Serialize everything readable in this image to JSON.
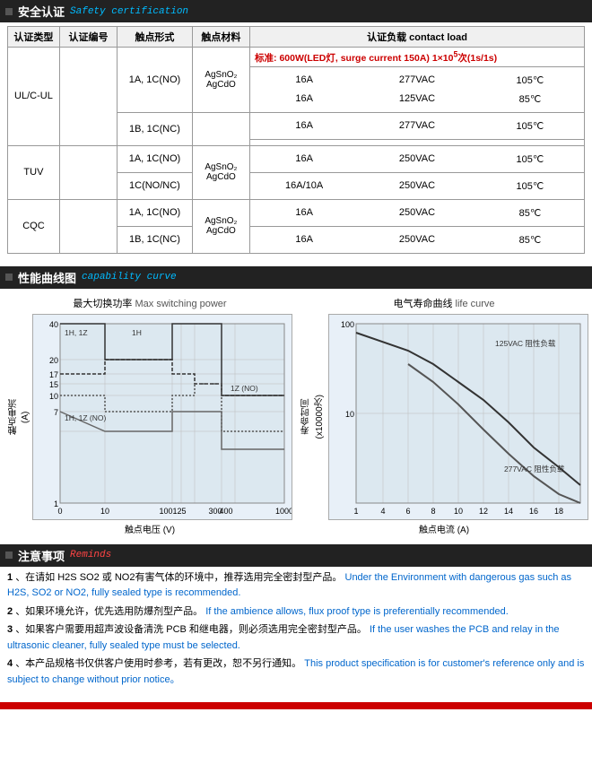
{
  "safety_section": {
    "title_zh": "安全认证",
    "title_en": "Safety certification",
    "table": {
      "headers": [
        "认证类型",
        "认证编号",
        "触点形式",
        "触点材料",
        "认证负载 contact load"
      ],
      "rows": [
        {
          "type": "UL/C-UL",
          "number": "",
          "forms": [
            "1A, 1C(NO)",
            "1B, 1C(NC)"
          ],
          "materials": [
            "AgSnO₂",
            "AgCdO"
          ],
          "loads": [
            {
              "bold": true,
              "text": "标准: 600W(LED灯, surge current 150A) 1×10⁵次(1s/1s)"
            },
            {
              "value": "16A",
              "voltage": "277VAC",
              "temp": "105℃"
            },
            {
              "value": "16A",
              "voltage": "125VAC",
              "temp": "85℃"
            },
            {
              "value": "16A",
              "voltage": "277VAC",
              "temp": "105℃"
            }
          ]
        },
        {
          "type": "TUV",
          "number": "",
          "forms": [
            "1A, 1C(NO)",
            "1C(NO/NC)"
          ],
          "materials": [
            "AgSnO₂",
            "AgCdO"
          ],
          "loads": [
            {
              "value": "16A",
              "voltage": "250VAC",
              "temp": "105℃"
            },
            {
              "value": "16A/10A",
              "voltage": "250VAC",
              "temp": "105℃"
            }
          ]
        },
        {
          "type": "CQC",
          "number": "",
          "forms": [
            "1A, 1C(NO)",
            "1B, 1C(NC)"
          ],
          "materials": [
            "AgSnO₂",
            "AgCdO"
          ],
          "loads": [
            {
              "value": "16A",
              "voltage": "250VAC",
              "temp": "85℃"
            },
            {
              "value": "16A",
              "voltage": "250VAC",
              "temp": "85℃"
            }
          ]
        }
      ]
    }
  },
  "capability_section": {
    "title_zh": "性能曲线图",
    "title_en": "capability curve",
    "chart1": {
      "title_zh": "最大切换功率",
      "title_en": "Max switching power",
      "x_label_zh": "触点电压",
      "x_label_en": "(V)",
      "y_label_zh": "触点电流",
      "y_label_en": "(A)",
      "x_axis": [
        "0",
        "10",
        "100",
        "125",
        "300",
        "400",
        "1000"
      ],
      "y_axis": [
        "40",
        "20",
        "17",
        "15",
        "10",
        "7",
        "1"
      ],
      "curves": [
        "1H, 1Z",
        "1H",
        "1Z (NO)",
        "1H, 1Z (NO)"
      ]
    },
    "chart2": {
      "title_zh": "电气寿命曲线",
      "title_en": "life curve",
      "x_label_zh": "触点电流",
      "x_label_en": "(A)",
      "y_label_zh": "寿命时间",
      "y_label_en": "(x10000次)",
      "x_axis": [
        "1",
        "4",
        "6",
        "8",
        "10",
        "12",
        "14",
        "16",
        "18"
      ],
      "y_axis": [
        "100",
        "10"
      ],
      "curves": [
        "125VAC 阻性负载",
        "277VAC 阻性负载"
      ]
    }
  },
  "notes_section": {
    "title_zh": "注意事项",
    "title_en": "Reminds",
    "items": [
      {
        "num": "1",
        "zh": "在请如 H2S SO2 或 NO2有害气体的环境中，推荐选用完全密封型产品。",
        "en": "Under the Environment with dangerous gas such as H2S, SO2 or NO2, fully sealed type is recommended."
      },
      {
        "num": "2",
        "zh": "如果环境允许，优先选用防爆剂型产品。",
        "en": "If the ambience allows, flux proof type is preferentially recommended."
      },
      {
        "num": "3",
        "zh": "如果客户需要用超声波设备清洗 PCB 和继电器，则必须选用完全密封型产品。",
        "en": "If the user washes the PCB and relay in the ultrasonic cleaner, fully sealed type must be selected."
      },
      {
        "num": "4",
        "zh": "本产品规格书仅供客户使用时参考，若有更改，恕不另行通知。",
        "en": "This product specification is for customer's reference only and is subject to change without prior notice。"
      }
    ]
  }
}
